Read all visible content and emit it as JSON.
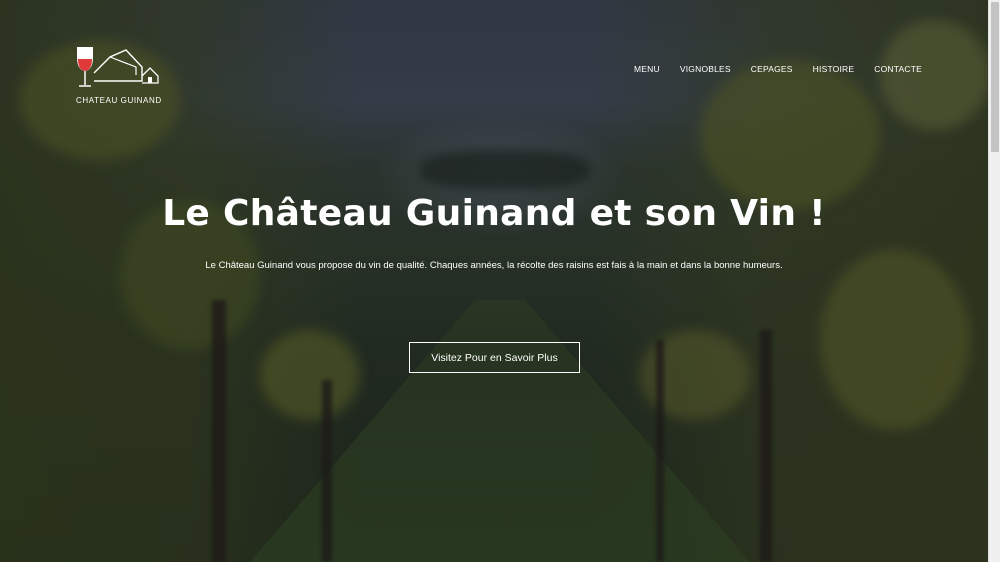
{
  "brand": {
    "name": "CHATEAU GUINAND",
    "logo_icon": "wine-glass-chateau-logo",
    "accent_color": "#e0393a"
  },
  "nav": {
    "items": [
      {
        "label": "MENU"
      },
      {
        "label": "VIGNOBLES"
      },
      {
        "label": "CEPAGES"
      },
      {
        "label": "HISTOIRE"
      },
      {
        "label": "CONTACTE"
      }
    ]
  },
  "hero": {
    "title": "Le Château Guinand et son Vin !",
    "subtitle": "Le Château Guinand vous propose du vin de qualité. Chaques années, la récolte des raisins est fais à la main et dans la bonne humeurs.",
    "cta_label": "Visitez Pour en Savoir Plus"
  }
}
